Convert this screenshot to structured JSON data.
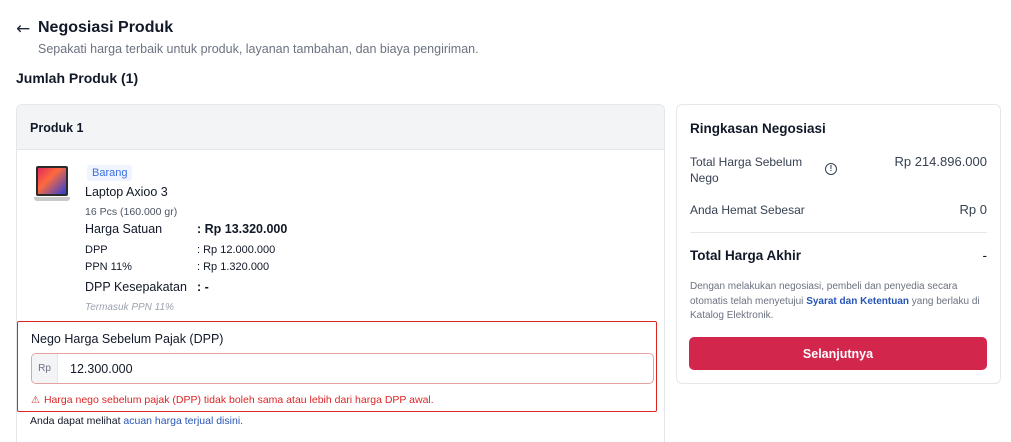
{
  "header": {
    "back_icon": "arrow-left-icon",
    "title": "Negosiasi Produk",
    "subtitle": "Sepakati harga terbaik untuk produk, layanan tambahan, dan biaya pengiriman."
  },
  "product_count_label": "Jumlah Produk (1)",
  "product": {
    "header": "Produk 1",
    "image_icon": "laptop-icon",
    "badge": "Barang",
    "name": "Laptop Axioo 3",
    "qty": "16 Pcs (160.000 gr)",
    "prices": [
      {
        "label": "Harga Satuan",
        "value": ": Rp 13.320.000"
      },
      {
        "label": "DPP",
        "value": ": Rp 12.000.000"
      },
      {
        "label": "PPN 11%",
        "value": ": Rp 1.320.000"
      },
      {
        "label": "DPP Kesepakatan",
        "value": ": -"
      }
    ],
    "included_note": "Termasuk PPN 11%"
  },
  "nego": {
    "label": "Nego Harga Sebelum Pajak (DPP)",
    "prefix": "Rp",
    "value": "12.300.000",
    "error": "Harga nego sebelum pajak (DPP) tidak boleh sama atau lebih dari harga DPP awal.",
    "error_icon": "warning-icon"
  },
  "reference": {
    "text": "Anda dapat melihat",
    "link": "acuan harga terjual disini."
  },
  "summary": {
    "title": "Ringkasan Negosiasi",
    "total_before_label": "Total Harga Sebelum Nego",
    "total_before_value": "Rp 214.896.000",
    "info_icon": "info-icon",
    "saving_label": "Anda Hemat Sebesar",
    "saving_value": "Rp 0",
    "final_label": "Total Harga Akhir",
    "final_value": "-",
    "note_pre": "Dengan melakukan negosiasi, pembeli dan penyedia secara otomatis telah menyetujui",
    "note_link": "Syarat dan Ketentuan",
    "note_post": "yang berlaku di Katalog Elektronik.",
    "next_button": "Selanjutnya"
  },
  "colors": {
    "primary": "#d3264d",
    "error": "#dc2626",
    "link": "#2755b6",
    "badge_text": "#3b6fe0"
  }
}
